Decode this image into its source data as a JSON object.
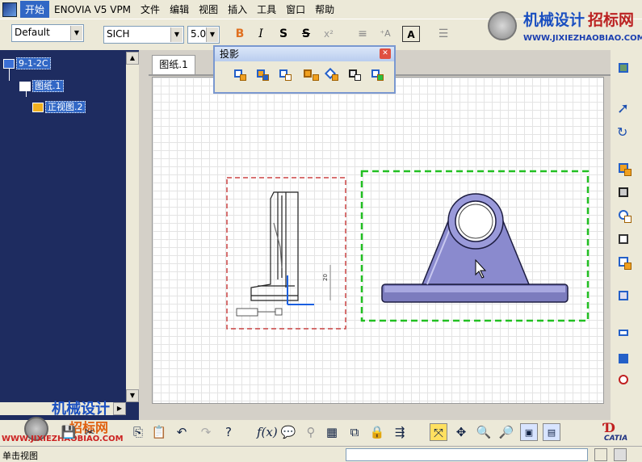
{
  "menu": {
    "items": [
      "开始",
      "ENOVIA V5 VPM",
      "文件",
      "编辑",
      "视图",
      "插入",
      "工具",
      "窗口",
      "帮助"
    ]
  },
  "toolbar": {
    "style_value": "Default",
    "font_value": "SICH",
    "font_size_value": "5.0",
    "bold_glyph": "B",
    "italic_glyph": "I",
    "underline_glyph": "S",
    "strike_glyph": "S",
    "superscript_glyph": "x²"
  },
  "watermark": {
    "top_title": "机械设计",
    "top_title_2": "招标网",
    "top_url": "WWW.JIXIEZHAOBIAO.COM",
    "bottom_title": "机械设计",
    "bottom_title_2": "招标网",
    "bottom_url": "WWW.JIXIEZHAOBIAO.COM"
  },
  "tree": {
    "nodes": [
      {
        "label": "9-1-2C",
        "icon": "drawing-icon"
      },
      {
        "label": "图纸.1",
        "icon": "sheet-icon"
      },
      {
        "label": "正视图.2",
        "icon": "view-icon"
      }
    ]
  },
  "sheet": {
    "tab_label": "图纸.1"
  },
  "projection_panel": {
    "title": "投影",
    "buttons": [
      "front-view-icon",
      "unfolded-view-icon",
      "view-from-3d-icon",
      "projection-view-icon",
      "auxiliary-view-icon",
      "isometric-view-icon",
      "advanced-front-view-icon"
    ]
  },
  "drawing": {
    "dimension_text": "20",
    "colors": {
      "view_frame_red": "#c44",
      "view_frame_green": "#22c022",
      "part_fill": "#8080c8",
      "axis_blue": "#1a5fe0"
    }
  },
  "status": {
    "text": "单击视图"
  },
  "catia_logo_text": "CATIA"
}
